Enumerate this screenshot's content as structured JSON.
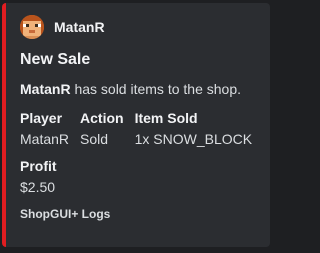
{
  "embed": {
    "accent_color": "#e11d21",
    "author": {
      "name": "MatanR",
      "avatar_icon": "minecraft-head-avatar"
    },
    "title": "New Sale",
    "description": {
      "player": "MatanR",
      "text": "has sold items to the shop."
    },
    "fields": [
      {
        "name": "Player",
        "value": "MatanR"
      },
      {
        "name": "Action",
        "value": "Sold"
      },
      {
        "name": "Item Sold",
        "value": "1x SNOW_BLOCK"
      }
    ],
    "profit": {
      "name": "Profit",
      "value": "$2.50"
    },
    "footer": "ShopGUI+ Logs"
  }
}
